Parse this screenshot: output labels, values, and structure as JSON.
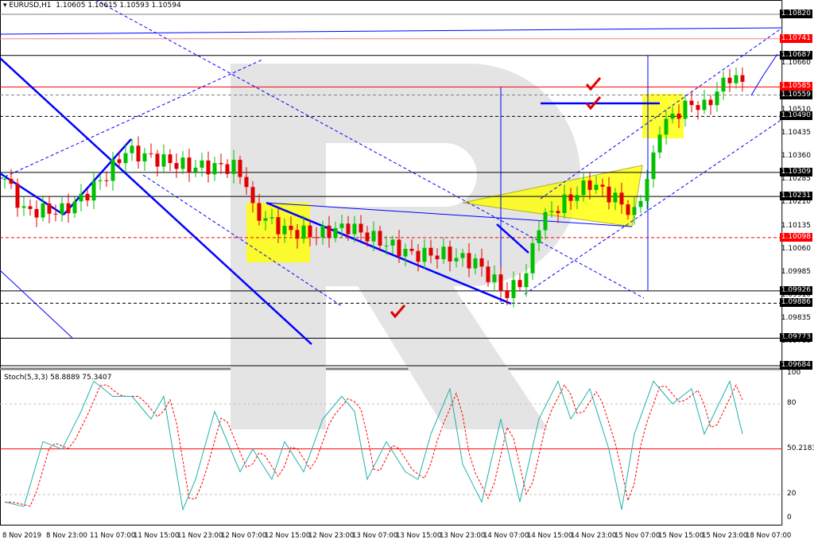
{
  "header": {
    "symbol": "EURUSD,H1",
    "ohlc": "1.10605 1.10615 1.10593 1.10594"
  },
  "stoch": {
    "label": "Stoch(5,3,3) 58.8889 75.3407",
    "levels": [
      "100",
      "80",
      "50.2183",
      "20",
      "0"
    ],
    "k_waypoints": [
      [
        0,
        15
      ],
      [
        3,
        12
      ],
      [
        6,
        55
      ],
      [
        9,
        50
      ],
      [
        12,
        75
      ],
      [
        14,
        95
      ],
      [
        17,
        85
      ],
      [
        20,
        85
      ],
      [
        23,
        70
      ],
      [
        25,
        85
      ],
      [
        28,
        10
      ],
      [
        30,
        30
      ],
      [
        33,
        75
      ],
      [
        37,
        35
      ],
      [
        39,
        50
      ],
      [
        42,
        30
      ],
      [
        44,
        55
      ],
      [
        47,
        35
      ],
      [
        50,
        70
      ],
      [
        53,
        85
      ],
      [
        55,
        75
      ],
      [
        57,
        30
      ],
      [
        60,
        55
      ],
      [
        63,
        35
      ],
      [
        65,
        30
      ],
      [
        67,
        60
      ],
      [
        70,
        90
      ],
      [
        72,
        40
      ],
      [
        75,
        15
      ],
      [
        78,
        70
      ],
      [
        81,
        15
      ],
      [
        84,
        70
      ],
      [
        87,
        95
      ],
      [
        89,
        70
      ],
      [
        92,
        90
      ],
      [
        95,
        50
      ],
      [
        97,
        10
      ],
      [
        99,
        60
      ],
      [
        102,
        95
      ],
      [
        105,
        80
      ],
      [
        108,
        90
      ],
      [
        110,
        60
      ],
      [
        114,
        95
      ],
      [
        116,
        60
      ]
    ]
  },
  "price_axis": {
    "max": 1.1082,
    "min": 1.09684,
    "ticks": [
      "1.10660",
      "1.10510",
      "1.10435",
      "1.10360",
      "1.10285",
      "1.10210",
      "1.10135",
      "1.10060",
      "1.09985",
      "1.09910",
      "1.09835",
      "1.09760"
    ],
    "levels": [
      {
        "label": "1.10820",
        "style": "box",
        "line": "#808080"
      },
      {
        "label": "1.10741",
        "style": "red",
        "line": "#f08080"
      },
      {
        "label": "1.10687",
        "style": "box",
        "line": "#000000"
      },
      {
        "label": "1.10585",
        "style": "red",
        "line": "#ff0000"
      },
      {
        "label": "1.10559",
        "style": "box",
        "line": "#808080",
        "dash": true
      },
      {
        "label": "1.10490",
        "style": "box",
        "line": "#000000",
        "dash": true
      },
      {
        "label": "1.10309",
        "style": "box",
        "line": "#000000"
      },
      {
        "label": "1.10231",
        "style": "box",
        "line": "#000000"
      },
      {
        "label": "1.10098",
        "style": "red",
        "line": "#ff0000",
        "dash": true
      },
      {
        "label": "1.09926",
        "style": "box",
        "line": "#000000"
      },
      {
        "label": "1.09886",
        "style": "box",
        "line": "#000000",
        "dash": true
      },
      {
        "label": "1.09773",
        "style": "box",
        "line": "#000000"
      },
      {
        "label": "1.09684",
        "style": "box",
        "line": "#000000"
      }
    ]
  },
  "price_waypoints": [
    [
      0,
      1.10288
    ],
    [
      3,
      1.10185
    ],
    [
      9,
      1.10185
    ],
    [
      12,
      1.10224
    ],
    [
      16,
      1.10301
    ],
    [
      19,
      1.10378
    ],
    [
      24,
      1.10352
    ],
    [
      29,
      1.10327
    ],
    [
      36,
      1.10327
    ],
    [
      38,
      1.10275
    ],
    [
      39,
      1.10185
    ],
    [
      44,
      1.10121
    ],
    [
      49,
      1.10108
    ],
    [
      54,
      1.10134
    ],
    [
      58,
      1.10095
    ],
    [
      64,
      1.10044
    ],
    [
      69,
      1.10044
    ],
    [
      74,
      1.10018
    ],
    [
      79,
      1.09915
    ],
    [
      82,
      1.0998
    ],
    [
      84,
      1.10147
    ],
    [
      87,
      1.10198
    ],
    [
      92,
      1.10275
    ],
    [
      96,
      1.10224
    ],
    [
      99,
      1.10172
    ],
    [
      102,
      1.10352
    ],
    [
      103,
      1.10455
    ],
    [
      106,
      1.10506
    ],
    [
      108,
      1.10532
    ],
    [
      110,
      1.10519
    ],
    [
      114,
      1.10622
    ],
    [
      116,
      1.10596
    ]
  ],
  "time_axis": [
    "8 Nov 2019",
    "8 Nov 23:00",
    "11 Nov 07:00",
    "11 Nov 15:00",
    "11 Nov 23:00",
    "12 Nov 07:00",
    "12 Nov 15:00",
    "12 Nov 23:00",
    "13 Nov 07:00",
    "13 Nov 15:00",
    "13 Nov 23:00",
    "14 Nov 07:00",
    "14 Nov 15:00",
    "14 Nov 23:00",
    "15 Nov 07:00",
    "15 Nov 15:00",
    "15 Nov 23:00",
    "18 Nov 07:00"
  ],
  "colors": {
    "bull": "#00c000",
    "bear": "#e00000",
    "stochK": "#20b2aa",
    "stochD": "#ff0000",
    "trend": "#0000ff",
    "zone": "#ffff00"
  }
}
